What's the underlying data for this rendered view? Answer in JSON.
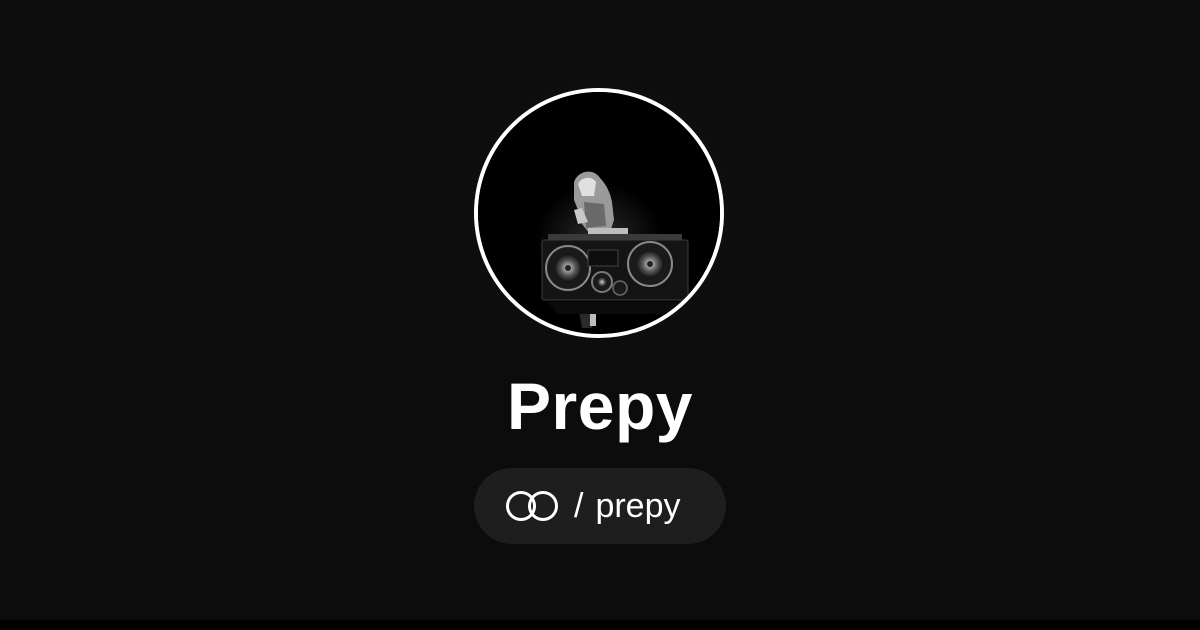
{
  "profile": {
    "name": "Prepy",
    "separator": "/",
    "username": "prepy"
  },
  "icons": {
    "avatar": "avatar-photo",
    "link": "linked-rings-icon"
  },
  "colors": {
    "background": "#0c0c0c",
    "pill": "#1e1e1e",
    "text": "#ffffff",
    "avatar_border": "#ffffff"
  }
}
